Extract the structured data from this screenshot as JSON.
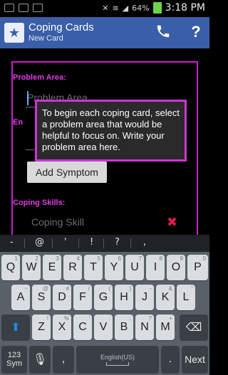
{
  "status_bar": {
    "battery_percent": "64%",
    "time": "3:18 PM",
    "icons": [
      "screenshot-icon",
      "mail-icon",
      "storage-icon",
      "mute-icon",
      "wifi-icon",
      "signal-icon",
      "battery-icon"
    ]
  },
  "app_bar": {
    "title": "Coping Cards",
    "subtitle": "New Card",
    "phone_icon": "phone-icon",
    "help_label": "?"
  },
  "form": {
    "problem_area_label": "Problem Area:",
    "problem_area_placeholder": "Problem Area",
    "emotions_label": "En",
    "add_symptom_label": "Add Symptom",
    "coping_skills_label": "Coping Skills:",
    "coping_skill_placeholder": "Coping Skill"
  },
  "tooltip": {
    "text": "To begin each coping card, select a problem area that would be helpful to focus on. Write your problem area here."
  },
  "keyboard": {
    "symbols": [
      "-",
      "@",
      "'",
      "!",
      "?",
      ","
    ],
    "row1": [
      {
        "l": "Q",
        "n": "1"
      },
      {
        "l": "W",
        "n": "2"
      },
      {
        "l": "E",
        "n": "3"
      },
      {
        "l": "R",
        "n": "4"
      },
      {
        "l": "T",
        "n": "5"
      },
      {
        "l": "Y",
        "n": "6"
      },
      {
        "l": "U",
        "n": "7"
      },
      {
        "l": "I",
        "n": "8"
      },
      {
        "l": "O",
        "n": "9"
      },
      {
        "l": "P",
        "n": "0"
      }
    ],
    "row2": [
      {
        "l": "A",
        "n": "~"
      },
      {
        "l": "S",
        "n": "@"
      },
      {
        "l": "D",
        "n": "#"
      },
      {
        "l": "F",
        "n": "/"
      },
      {
        "l": "G",
        "n": "("
      },
      {
        "l": "H",
        "n": ")"
      },
      {
        "l": "J",
        "n": "-"
      },
      {
        "l": "K",
        "n": "&"
      },
      {
        "l": "L",
        "n": "\""
      }
    ],
    "row3": [
      {
        "l": "Z",
        "n": "!"
      },
      {
        "l": "X",
        "n": "%"
      },
      {
        "l": "C",
        "n": "'"
      },
      {
        "l": "V",
        "n": ":"
      },
      {
        "l": "B",
        "n": ";"
      },
      {
        "l": "N",
        "n": "?"
      },
      {
        "l": "M",
        "n": "+"
      }
    ],
    "bottom": {
      "sym_label_1": "123",
      "sym_label_2": "Sym",
      "comma": ",",
      "space_label": "English(US)",
      "period": ".",
      "next": "Next"
    }
  }
}
